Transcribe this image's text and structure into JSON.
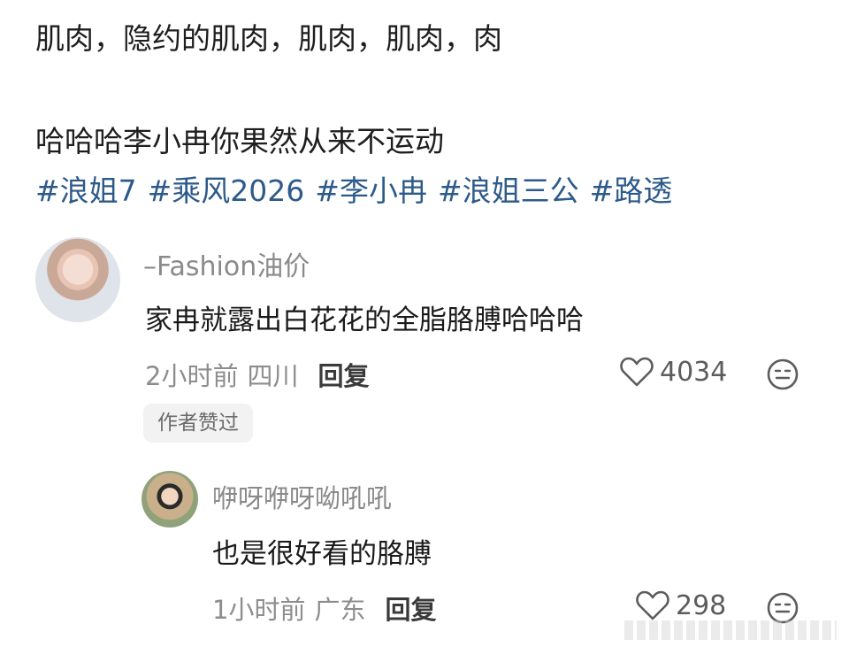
{
  "post": {
    "line1": "肌肉，隐约的肌肉，肌肉，肌肉，肉",
    "line2": "哈哈哈李小冉你果然从来不运动",
    "hashtags": [
      "#浪姐7",
      "#乘风2026",
      "#李小冉",
      "#浪姐三公",
      "#路透"
    ]
  },
  "comment": {
    "username": "–Fashion油价",
    "text": "家冉就露出白花花的全脂胳膊哈哈哈",
    "time": "2小时前",
    "location": "四川",
    "reply_label": "回复",
    "likes": "4034",
    "author_badge": "作者赞过"
  },
  "reply": {
    "username": "咿呀咿呀呦吼吼",
    "text": "也是很好看的胳膊",
    "time": "1小时前",
    "location": "广东",
    "reply_label": "回复",
    "likes": "298"
  },
  "icons": {
    "like": "heart-outline-icon",
    "emoji": "emoji-face-icon"
  },
  "colors": {
    "hashtag": "#2c5a8a",
    "meta": "#8d8d8d",
    "username": "#8a8a8a"
  }
}
